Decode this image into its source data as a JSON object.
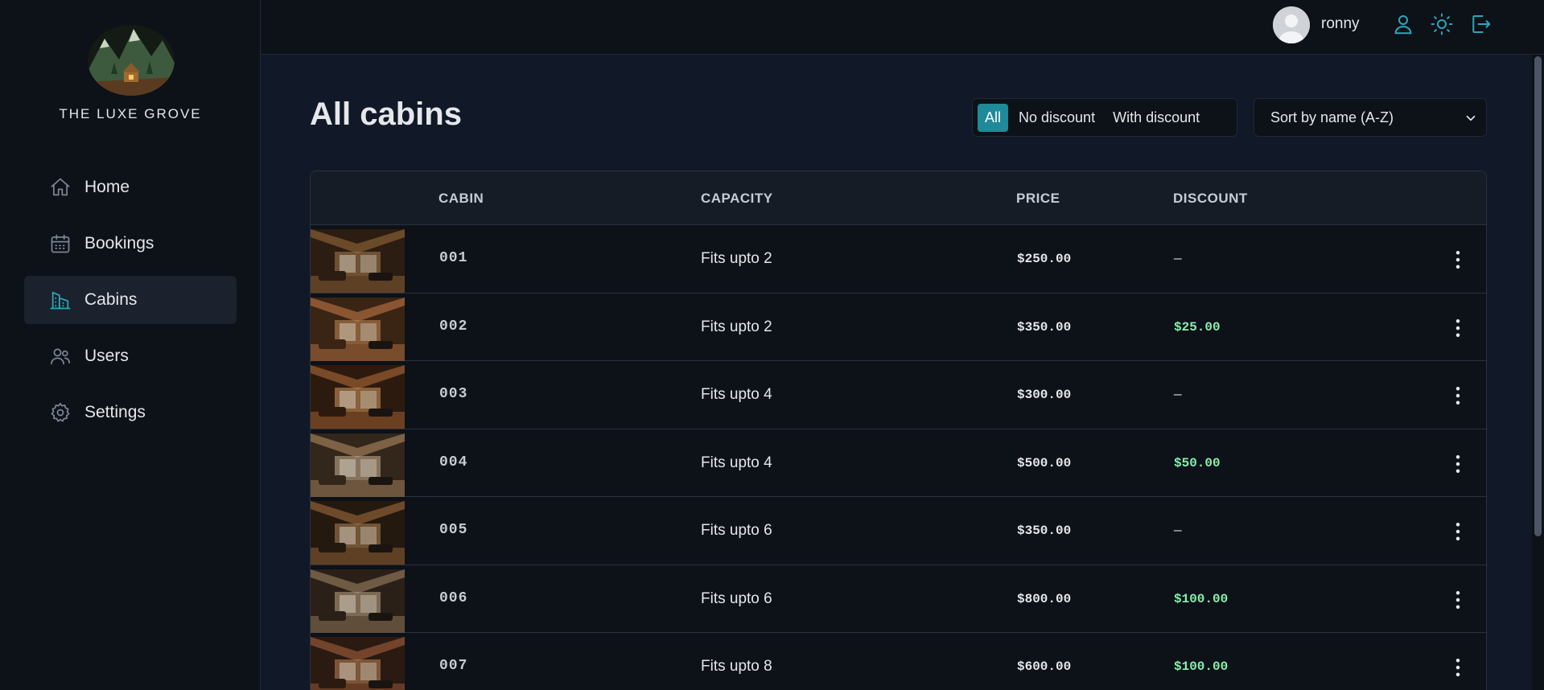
{
  "sidebar": {
    "brand": "THE LUXE GROVE",
    "items": [
      {
        "label": "Home",
        "icon": "home-icon"
      },
      {
        "label": "Bookings",
        "icon": "calendar-icon"
      },
      {
        "label": "Cabins",
        "icon": "buildings-icon",
        "active": true
      },
      {
        "label": "Users",
        "icon": "users-icon"
      },
      {
        "label": "Settings",
        "icon": "gear-icon"
      }
    ]
  },
  "header": {
    "username": "ronny",
    "icons": [
      "user-icon",
      "sun-icon",
      "logout-icon"
    ]
  },
  "main": {
    "title": "All cabins",
    "filter": {
      "options": [
        "All",
        "No discount",
        "With discount"
      ],
      "active": "All"
    },
    "sort": {
      "selected": "Sort by name (A-Z)"
    }
  },
  "table": {
    "columns": [
      "CABIN",
      "CAPACITY",
      "PRICE",
      "DISCOUNT"
    ],
    "rows": [
      {
        "name": "001",
        "capacity": "Fits upto 2",
        "price": "$250.00",
        "discount": "—"
      },
      {
        "name": "002",
        "capacity": "Fits upto 2",
        "price": "$350.00",
        "discount": "$25.00"
      },
      {
        "name": "003",
        "capacity": "Fits upto 4",
        "price": "$300.00",
        "discount": "—"
      },
      {
        "name": "004",
        "capacity": "Fits upto 4",
        "price": "$500.00",
        "discount": "$50.00"
      },
      {
        "name": "005",
        "capacity": "Fits upto 6",
        "price": "$350.00",
        "discount": "—"
      },
      {
        "name": "006",
        "capacity": "Fits upto 6",
        "price": "$800.00",
        "discount": "$100.00"
      },
      {
        "name": "007",
        "capacity": "Fits upto 8",
        "price": "$600.00",
        "discount": "$100.00"
      }
    ]
  },
  "colors": {
    "accent": "#1f8a99",
    "discount": "#86efac",
    "background": "#111827",
    "panel": "#0d1118"
  }
}
